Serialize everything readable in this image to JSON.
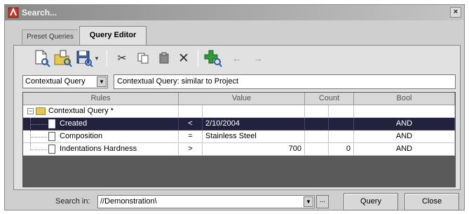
{
  "window": {
    "title": "Search..."
  },
  "tabs": [
    {
      "label": "Preset Queries"
    },
    {
      "label": "Query Editor"
    }
  ],
  "toolbar": {
    "icons": [
      "new-query-icon",
      "open-folder-icon",
      "save-icon",
      "save-dropdown-icon",
      "cut-icon",
      "copy-icon",
      "paste-icon",
      "delete-icon",
      "add-rule-icon",
      "back-arrow-icon",
      "forward-arrow-icon"
    ]
  },
  "query_type": {
    "selected": "Contextual Query"
  },
  "query_description": {
    "value": "Contextual Query: similar to Project"
  },
  "grid": {
    "columns": [
      "Rules",
      "Value",
      "Count",
      "Bool"
    ],
    "root": {
      "rule": "Contextual Query *"
    },
    "rows": [
      {
        "rule": "Created",
        "op": "<",
        "value": "2/10/2004",
        "count": "",
        "bool": "AND",
        "selected": true
      },
      {
        "rule": "Composition",
        "op": "=",
        "value": "Stainless Steel",
        "count": "",
        "bool": "AND",
        "selected": false
      },
      {
        "rule": "Indentations Hardness",
        "op": ">",
        "value": "700",
        "count": "0",
        "bool": "AND",
        "selected": false
      }
    ]
  },
  "search_in": {
    "label": "Search in:",
    "value": "//Demonstration\\",
    "browse": "..."
  },
  "buttons": {
    "query": "Query",
    "close": "Close"
  },
  "colors": {
    "selection": "#22223e",
    "grid_background": "#5a5a5a",
    "folder": "#e7c652",
    "add_icon": "#2e9a3a"
  }
}
